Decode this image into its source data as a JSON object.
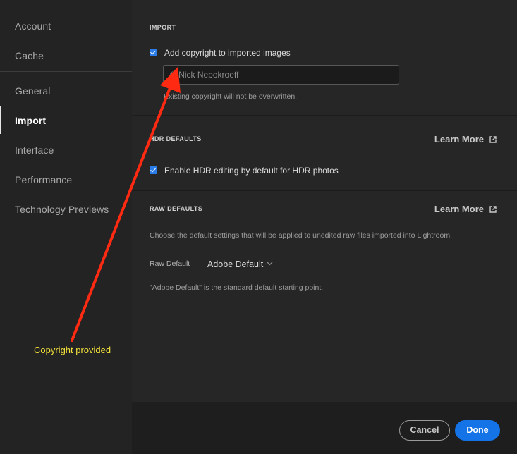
{
  "sidebar": {
    "items": [
      {
        "label": "Account",
        "active": false
      },
      {
        "label": "Cache",
        "active": false
      },
      {
        "label": "General",
        "active": false
      },
      {
        "label": "Import",
        "active": true
      },
      {
        "label": "Interface",
        "active": false
      },
      {
        "label": "Performance",
        "active": false
      },
      {
        "label": "Technology Previews",
        "active": false
      }
    ]
  },
  "import_section": {
    "title": "IMPORT",
    "copyright_checkbox": {
      "label": "Add copyright to imported images",
      "checked": true
    },
    "copyright_input": {
      "value": "© Nick Nepokroeff",
      "placeholder": ""
    },
    "copyright_note": "Existing copyright will not be overwritten."
  },
  "hdr_section": {
    "title": "HDR DEFAULTS",
    "learn_more": "Learn More",
    "hdr_checkbox": {
      "label": "Enable HDR editing by default for HDR photos",
      "checked": true
    }
  },
  "raw_section": {
    "title": "RAW DEFAULTS",
    "learn_more": "Learn More",
    "description": "Choose the default settings that will be applied to unedited raw files imported into Lightroom.",
    "raw_default_label": "Raw Default",
    "raw_default_value": "Adobe Default",
    "note": "\"Adobe Default\" is the standard default starting point."
  },
  "footer": {
    "cancel_label": "Cancel",
    "done_label": "Done"
  },
  "annotation": {
    "text": "Copyright provided",
    "arrow_color": "#ff2a12",
    "text_color": "#f4e23a"
  },
  "colors": {
    "accent": "#1473e6",
    "checkbox": "#2b7de9"
  },
  "icons": [
    "external-link-icon",
    "chevron-down-icon",
    "checkmark-icon"
  ]
}
